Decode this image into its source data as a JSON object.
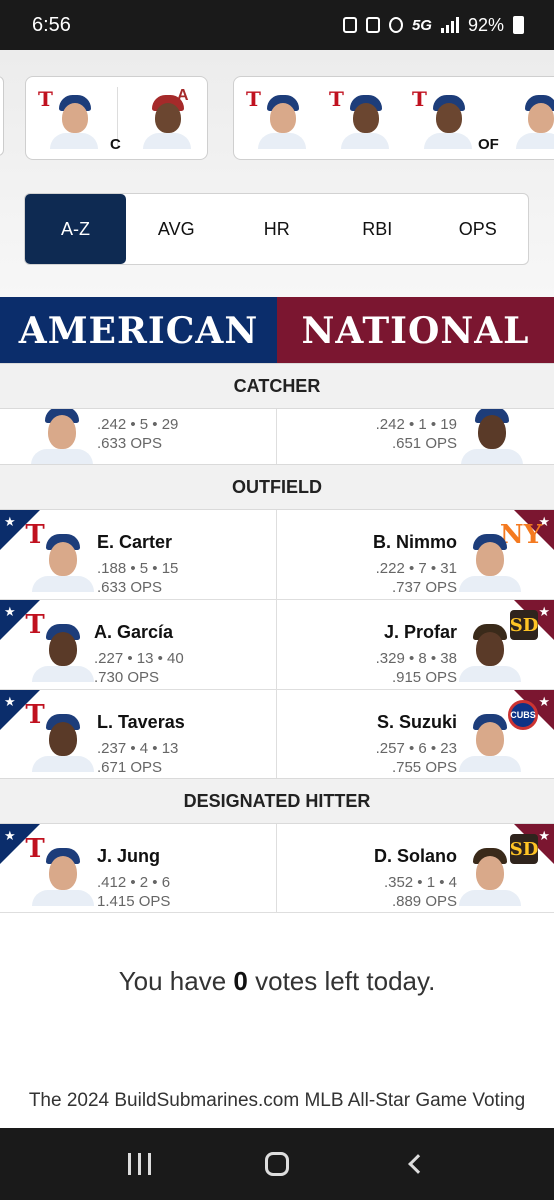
{
  "status_bar": {
    "time": "6:56",
    "network": "5G",
    "battery": "92%"
  },
  "selections": {
    "catcher_label": "C",
    "outfield_label": "OF"
  },
  "sort_tabs": [
    {
      "label": "A-Z",
      "active": true
    },
    {
      "label": "AVG",
      "active": false
    },
    {
      "label": "HR",
      "active": false
    },
    {
      "label": "RBI",
      "active": false
    },
    {
      "label": "OPS",
      "active": false
    }
  ],
  "leagues": {
    "american": "AMERICAN",
    "national": "NATIONAL"
  },
  "sections": {
    "catcher": "CATCHER",
    "outfield": "OUTFIELD",
    "designated_hitter": "DESIGNATED HITTER"
  },
  "catcher_row": {
    "al": {
      "stats": ".242 • 5 • 29",
      "ops": ".633 OPS"
    },
    "nl": {
      "stats": ".242 • 1 • 19",
      "ops": ".651 OPS"
    }
  },
  "outfield_rows": [
    {
      "al": {
        "name": "E. Carter",
        "stats": ".188 • 5 • 15",
        "ops": ".633 OPS",
        "team_logo": "T"
      },
      "nl": {
        "name": "B. Nimmo",
        "stats": ".222 • 7 • 31",
        "ops": ".737 OPS",
        "team_logo": "NY"
      }
    },
    {
      "al": {
        "name": "A. García",
        "stats": ".227 • 13 • 40",
        "ops": ".730 OPS",
        "team_logo": "T"
      },
      "nl": {
        "name": "J. Profar",
        "stats": ".329 • 8 • 38",
        "ops": ".915 OPS",
        "team_logo": "SD"
      }
    },
    {
      "al": {
        "name": "L. Taveras",
        "stats": ".237 • 4 • 13",
        "ops": ".671 OPS",
        "team_logo": "T"
      },
      "nl": {
        "name": "S. Suzuki",
        "stats": ".257 • 6 • 23",
        "ops": ".755 OPS",
        "team_logo": "CUBS"
      }
    }
  ],
  "dh_row": {
    "al": {
      "name": "J. Jung",
      "stats": ".412 • 2 • 6",
      "ops": "1.415 OPS",
      "team_logo": "T"
    },
    "nl": {
      "name": "D. Solano",
      "stats": ".352 • 1 • 4",
      "ops": ".889 OPS",
      "team_logo": "SD"
    }
  },
  "votes": {
    "prefix": "You have",
    "count": "0",
    "suffix": "votes left today."
  },
  "footer": "The 2024 BuildSubmarines.com MLB All-Star Game Voting",
  "colors": {
    "al_blue": "#0b2d6b",
    "nl_red": "#7b1630",
    "active_tab": "#0e2a52"
  },
  "icons": {
    "team_rangers": "rangers-logo-icon",
    "team_mets": "mets-logo-icon",
    "team_padres": "padres-logo-icon",
    "team_cubs": "cubs-logo-icon",
    "star": "star-icon"
  }
}
